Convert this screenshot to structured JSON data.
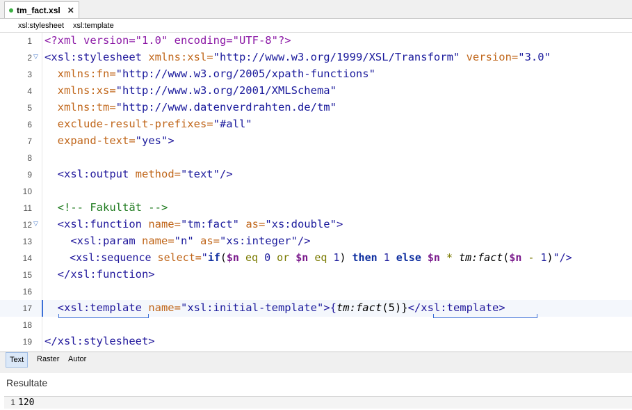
{
  "tab": {
    "filename": "tm_fact.xsl",
    "close": "✕"
  },
  "breadcrumbs": [
    "xsl:stylesheet",
    "xsl:template"
  ],
  "editor": {
    "line_numbers": [
      "1",
      "2",
      "3",
      "4",
      "5",
      "6",
      "7",
      "8",
      "9",
      "10",
      "11",
      "12",
      "13",
      "14",
      "15",
      "16",
      "17",
      "18",
      "19"
    ],
    "lines": {
      "l1": [
        "<?xml version=\"1.0\" encoding=\"UTF-8\"?>"
      ],
      "l2": [
        "<xsl:stylesheet",
        " xmlns:xsl=",
        "\"http://www.w3.org/1999/XSL/Transform\"",
        " version=",
        "\"3.0\""
      ],
      "l3": [
        "  xmlns:fn=",
        "\"http://www.w3.org/2005/xpath-functions\""
      ],
      "l4": [
        "  xmlns:xs=",
        "\"http://www.w3.org/2001/XMLSchema\""
      ],
      "l5": [
        "  xmlns:tm=",
        "\"http://www.datenverdrahten.de/tm\""
      ],
      "l6": [
        "  exclude-result-prefixes=",
        "\"#all\""
      ],
      "l7": [
        "  expand-text=",
        "\"yes\"",
        ">"
      ],
      "l9": [
        "  <xsl:output",
        " method=",
        "\"text\"",
        "/>"
      ],
      "l11": [
        "  <!-- Fakultät -->"
      ],
      "l12": [
        "  <xsl:function",
        " name=",
        "\"tm:fact\"",
        " as=",
        "\"xs:double\"",
        ">"
      ],
      "l13": [
        "    <xsl:param",
        " name=",
        "\"n\"",
        " as=",
        "\"xs:integer\"",
        "/>"
      ],
      "l14": [
        "    <xsl:sequence",
        " select=",
        "\"",
        "if",
        "(",
        "$n",
        " eq ",
        "0",
        " or ",
        "$n",
        " eq ",
        "1",
        ") ",
        "then",
        " ",
        "1",
        " ",
        "else",
        " ",
        "$n",
        " * ",
        "tm:fact",
        "(",
        "$n",
        " - ",
        "1",
        ")",
        "\"",
        "/>"
      ],
      "l15": [
        "  </xsl:function>"
      ],
      "l17": [
        "  <xsl:template",
        " name=",
        "\"xsl:initial-template\"",
        ">{",
        "tm:fact",
        "(5)}",
        "</xsl:template>"
      ],
      "l19": [
        "</xsl:stylesheet>"
      ]
    }
  },
  "bottom_tabs": [
    "Text",
    "Raster",
    "Autor"
  ],
  "results": {
    "title": "Resultate",
    "line_number": "1",
    "value": "120"
  },
  "colors": {
    "accent": "#3b6fd6",
    "tag": "#21189c",
    "attribute": "#c0661a",
    "value": "#1a1a9c",
    "comment": "#1e7a1e",
    "prolog": "#8c1aa6"
  }
}
